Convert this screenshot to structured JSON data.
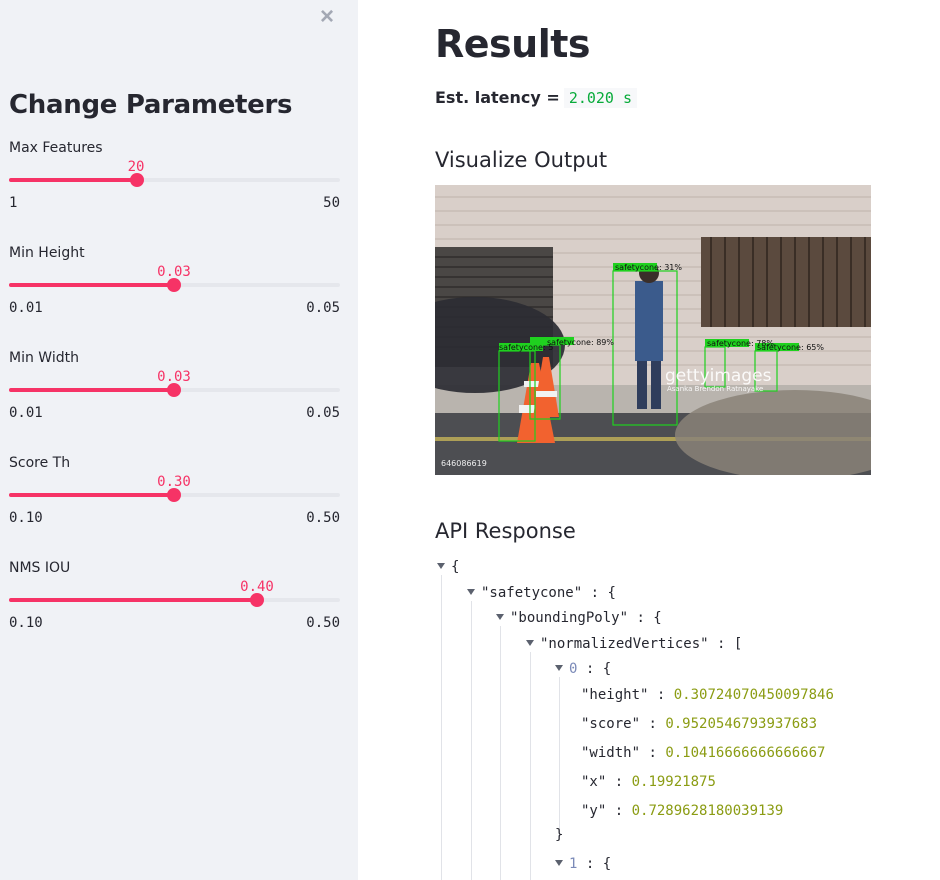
{
  "sidebar": {
    "title": "Change Parameters",
    "close_icon": "close-icon",
    "sliders": [
      {
        "label": "Max Features",
        "value": "20",
        "min": "1",
        "max": "50",
        "fraction": 0.3878
      },
      {
        "label": "Min Height",
        "value": "0.03",
        "min": "0.01",
        "max": "0.05",
        "fraction": 0.5
      },
      {
        "label": "Min Width",
        "value": "0.03",
        "min": "0.01",
        "max": "0.05",
        "fraction": 0.5
      },
      {
        "label": "Score Th",
        "value": "0.30",
        "min": "0.10",
        "max": "0.50",
        "fraction": 0.5
      },
      {
        "label": "NMS IOU",
        "value": "0.40",
        "min": "0.10",
        "max": "0.50",
        "fraction": 0.75
      }
    ]
  },
  "main": {
    "title": "Results",
    "latency_label": "Est. latency =",
    "latency_value": "2.020 s",
    "viz_heading": "Visualize Output",
    "image": {
      "detections": [
        {
          "label": "safetycone: 89%"
        },
        {
          "label": "safetycone: 5"
        },
        {
          "label": "safetycone: 31%"
        },
        {
          "label": "safetycone: 78%"
        },
        {
          "label": "safetycone: 65%"
        }
      ],
      "watermark": "gettyimages",
      "credit": "Asanka Brendon Ratnayake",
      "image_id": "646086619"
    },
    "api_heading": "API Response",
    "json": {
      "open_brace": "{",
      "key_safetycone": "\"safetycone\"",
      "key_boundingPoly": "\"boundingPoly\"",
      "key_normalizedVertices": "\"normalizedVertices\"",
      "index0": "0",
      "index1": "1",
      "fields": [
        {
          "key": "\"height\"",
          "value": "0.30724070450097846"
        },
        {
          "key": "\"score\"",
          "value": "0.9520546793937683"
        },
        {
          "key": "\"width\"",
          "value": "0.10416666666666667"
        },
        {
          "key": "\"x\"",
          "value": "0.19921875"
        },
        {
          "key": "\"y\"",
          "value": "0.7289628180039139"
        }
      ],
      "close_brace": "}"
    }
  }
}
